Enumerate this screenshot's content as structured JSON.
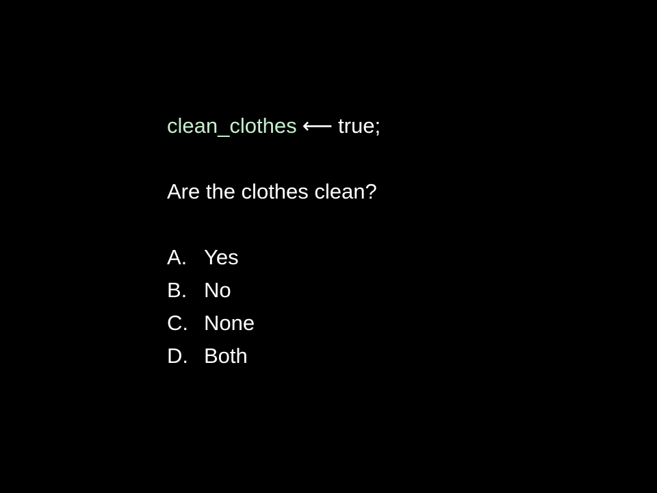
{
  "code": {
    "variable": "clean_clothes",
    "arrow": "⟵",
    "value": "true;",
    "variable_color": "#c6efce"
  },
  "question": "Are the clothes clean?",
  "options": [
    {
      "letter": "A.",
      "text": "Yes"
    },
    {
      "letter": "B.",
      "text": "No"
    },
    {
      "letter": "C.",
      "text": "None"
    },
    {
      "letter": "D.",
      "text": "Both"
    }
  ]
}
